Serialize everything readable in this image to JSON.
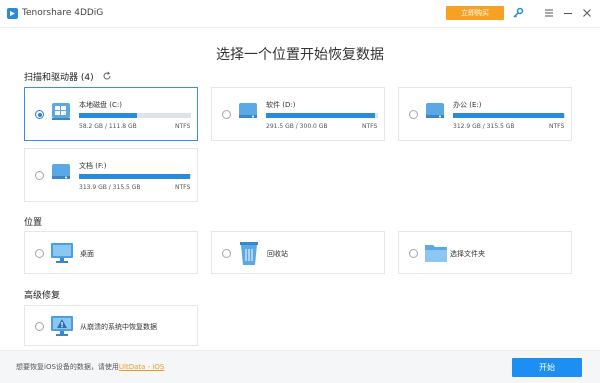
{
  "titlebar": {
    "app_title": "Tenorshare 4DDiG",
    "buy_label": "立即购买"
  },
  "main_title": "选择一个位置开始恢复数据",
  "drives_section": {
    "title": "扫描和驱动器 (4)",
    "drives": [
      {
        "name": "本地磁盘 (C:)",
        "size": "58.2 GB / 111.8 GB",
        "fs": "NTFS",
        "usage": 0.52,
        "selected": true
      },
      {
        "name": "软件 (D:)",
        "size": "291.5 GB / 300.0 GB",
        "fs": "NTFS",
        "usage": 0.97,
        "selected": false
      },
      {
        "name": "办公 (E:)",
        "size": "312.9 GB / 315.5 GB",
        "fs": "NTFS",
        "usage": 0.99,
        "selected": false
      },
      {
        "name": "文档 (F:)",
        "size": "313.9 GB / 315.5 GB",
        "fs": "NTFS",
        "usage": 0.995,
        "selected": false
      }
    ]
  },
  "location_section": {
    "title": "位置",
    "items": [
      {
        "label": "桌面",
        "icon": "monitor-icon"
      },
      {
        "label": "回收站",
        "icon": "recycle-bin-icon"
      },
      {
        "label": "选择文件夹",
        "icon": "folder-icon"
      }
    ]
  },
  "advanced_section": {
    "title": "高级修复",
    "items": [
      {
        "label": "从崩溃的系统中恢复数据",
        "icon": "crashed-system-icon"
      }
    ]
  },
  "footer": {
    "text": "想要恢复iOS设备的数据，请使用",
    "link": "UltData - iOS",
    "start_label": "开始"
  },
  "colors": {
    "accent": "#1d8ff2",
    "buy": "#f7a123",
    "link": "#f29a20"
  }
}
